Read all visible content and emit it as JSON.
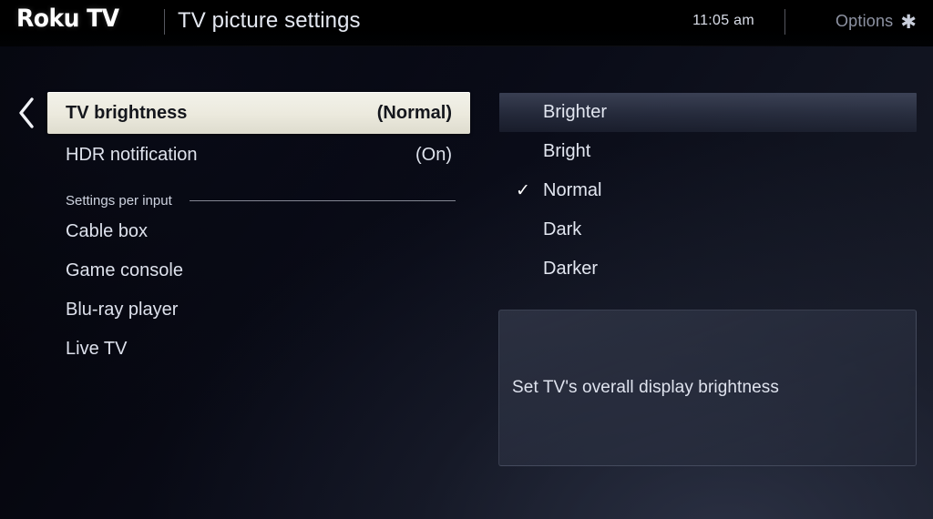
{
  "header": {
    "brand": "Roku TV",
    "title": "TV picture settings",
    "clock": "11:05 am",
    "options_label": "Options",
    "options_icon": "asterisk-star-icon",
    "back_icon": "chevron-left-icon"
  },
  "left_panel": {
    "settings": [
      {
        "label": "TV brightness",
        "value": "(Normal)",
        "selected": true
      },
      {
        "label": "HDR notification",
        "value": "(On)",
        "selected": false
      }
    ],
    "section_title": "Settings per input",
    "inputs": [
      {
        "label": "Cable box"
      },
      {
        "label": "Game console"
      },
      {
        "label": "Blu-ray player"
      },
      {
        "label": "Live TV"
      }
    ]
  },
  "right_panel": {
    "options": [
      {
        "label": "Brighter",
        "checked": false,
        "highlighted": true
      },
      {
        "label": "Bright",
        "checked": false,
        "highlighted": false
      },
      {
        "label": "Normal",
        "checked": true,
        "highlighted": false
      },
      {
        "label": "Dark",
        "checked": false,
        "highlighted": false
      },
      {
        "label": "Darker",
        "checked": false,
        "highlighted": false
      }
    ],
    "check_glyph": "✓",
    "description": "Set TV's overall display brightness"
  },
  "colors": {
    "selected_row_bg": "#eceade",
    "selected_row_text": "#14161c",
    "body_text": "#dfe3ed",
    "dim_text": "#8e93a3",
    "background_dark": "#05060e",
    "background_light": "#171a26"
  }
}
